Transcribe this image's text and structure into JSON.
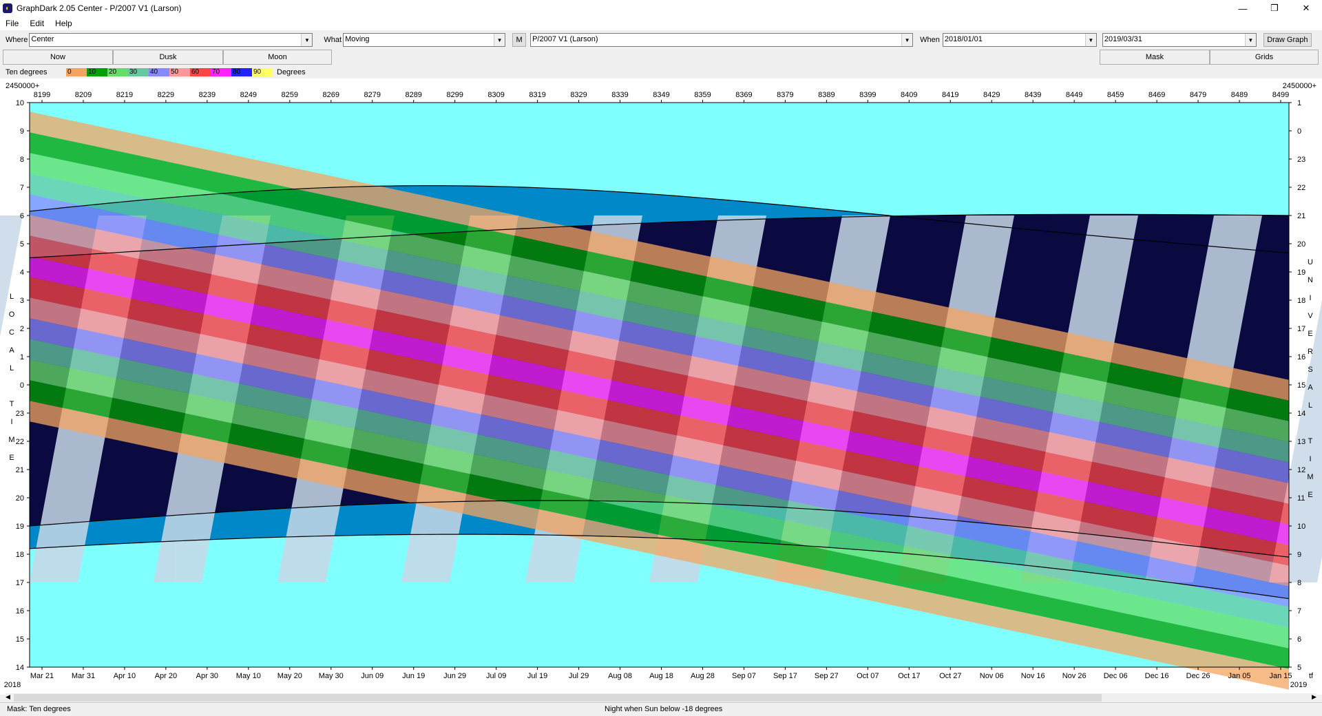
{
  "window": {
    "title": "GraphDark 2.05 Center  -  P/2007 V1 (Larson)",
    "min": "—",
    "restore": "❐",
    "close": "✕"
  },
  "menu": [
    "File",
    "Edit",
    "Help"
  ],
  "toolbar": {
    "where_label": "Where",
    "where_value": "Center",
    "what_label": "What",
    "what_value": "Moving",
    "m_button": "M",
    "object_value": "P/2007 V1 (Larson)",
    "when_label": "When",
    "when_start": "2018/01/01",
    "when_end": "2019/03/31",
    "draw_button": "Draw Graph"
  },
  "tabs": {
    "now": "Now",
    "dusk": "Dusk",
    "moon": "Moon",
    "mask": "Mask",
    "grids": "Grids"
  },
  "legend": {
    "label": "Ten degrees",
    "units": "Degrees",
    "entries": [
      {
        "text": "0",
        "color": "#f4a460"
      },
      {
        "text": "10",
        "color": "#00a000"
      },
      {
        "text": "20",
        "color": "#66dd66"
      },
      {
        "text": "30",
        "color": "#66c8a0"
      },
      {
        "text": "40",
        "color": "#8888ff"
      },
      {
        "text": "50",
        "color": "#ff9999"
      },
      {
        "text": "60",
        "color": "#ff4444"
      },
      {
        "text": "70",
        "color": "#ff22ff"
      },
      {
        "text": "80",
        "color": "#2222ff"
      },
      {
        "text": "90",
        "color": "#ffff66"
      }
    ]
  },
  "chart_data": {
    "type": "heatmap",
    "top_left_label": "2450000+",
    "top_right_label": "2450000+",
    "jd_ticks": [
      "8199",
      "8209",
      "8219",
      "8229",
      "8239",
      "8249",
      "8259",
      "8269",
      "8279",
      "8289",
      "8299",
      "8309",
      "8319",
      "8329",
      "8339",
      "8349",
      "8359",
      "8369",
      "8379",
      "8389",
      "8399",
      "8409",
      "8419",
      "8429",
      "8439",
      "8449",
      "8459",
      "8469",
      "8479",
      "8489",
      "8499"
    ],
    "date_ticks": [
      "Mar 21",
      "Mar 31",
      "Apr 10",
      "Apr 20",
      "Apr 30",
      "May 10",
      "May 20",
      "May 30",
      "Jun 09",
      "Jun 19",
      "Jun 29",
      "Jul 09",
      "Jul 19",
      "Jul 29",
      "Aug 08",
      "Aug 18",
      "Aug 28",
      "Sep 07",
      "Sep 17",
      "Sep 27",
      "Oct 07",
      "Oct 17",
      "Oct 27",
      "Nov 06",
      "Nov 16",
      "Nov 26",
      "Dec 06",
      "Dec 16",
      "Dec 26",
      "Jan 05",
      "Jan 15"
    ],
    "year_left": "2018",
    "year_right": "2019",
    "corner_right": "tf",
    "left_axis_label": "LOCAL TIME",
    "right_axis_label": "UNIVERSAL TIME",
    "left_ticks": [
      "10",
      "9",
      "8",
      "7",
      "6",
      "5",
      "4",
      "3",
      "2",
      "1",
      "0",
      "23",
      "22",
      "21",
      "20",
      "19",
      "18",
      "17",
      "16",
      "15",
      "14"
    ],
    "right_ticks": [
      "1",
      "0",
      "23",
      "22",
      "21",
      "20",
      "19",
      "18",
      "17",
      "16",
      "15",
      "14",
      "13",
      "12",
      "11",
      "10",
      "9",
      "8",
      "7",
      "6",
      "5"
    ],
    "day_color": "#80ffff",
    "night_color": "#0a0a40",
    "twilight_color": "#0088c8",
    "moon_color": "#c8d8e8"
  },
  "status": {
    "mask": "Mask:  Ten degrees",
    "night": "Night when Sun below -18 degrees"
  }
}
